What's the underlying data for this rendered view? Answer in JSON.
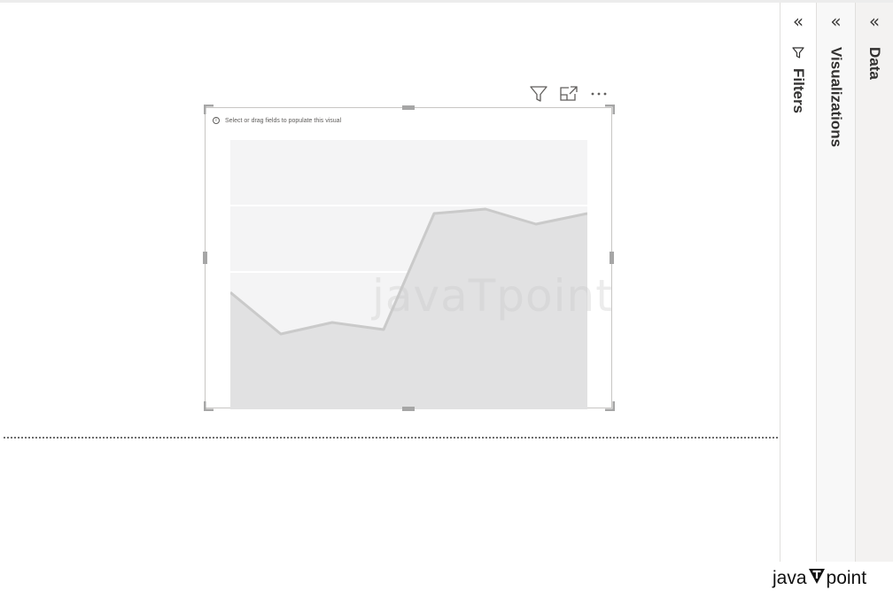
{
  "visual": {
    "hint_text": "Select or drag fields to populate this visual",
    "header_icons": [
      "filter-icon",
      "focus-mode-icon",
      "more-options-icon"
    ]
  },
  "panes": {
    "filters": {
      "label": "Filters",
      "collapse_glyph": "«",
      "icon": "filter-icon"
    },
    "visualizations": {
      "label": "Visualizations",
      "collapse_glyph": "«"
    },
    "data": {
      "label": "Data",
      "collapse_glyph": "«"
    }
  },
  "watermark": {
    "text": "javaTpoint"
  },
  "brand": {
    "prefix": "java",
    "suffix": "point",
    "logo": "T-logo-icon"
  },
  "colors": {
    "placeholder_fill": "#e1e1e2",
    "placeholder_line": "#c8c8c8",
    "placeholder_bg": "#f4f4f5",
    "handle": "#a6a6a6"
  }
}
